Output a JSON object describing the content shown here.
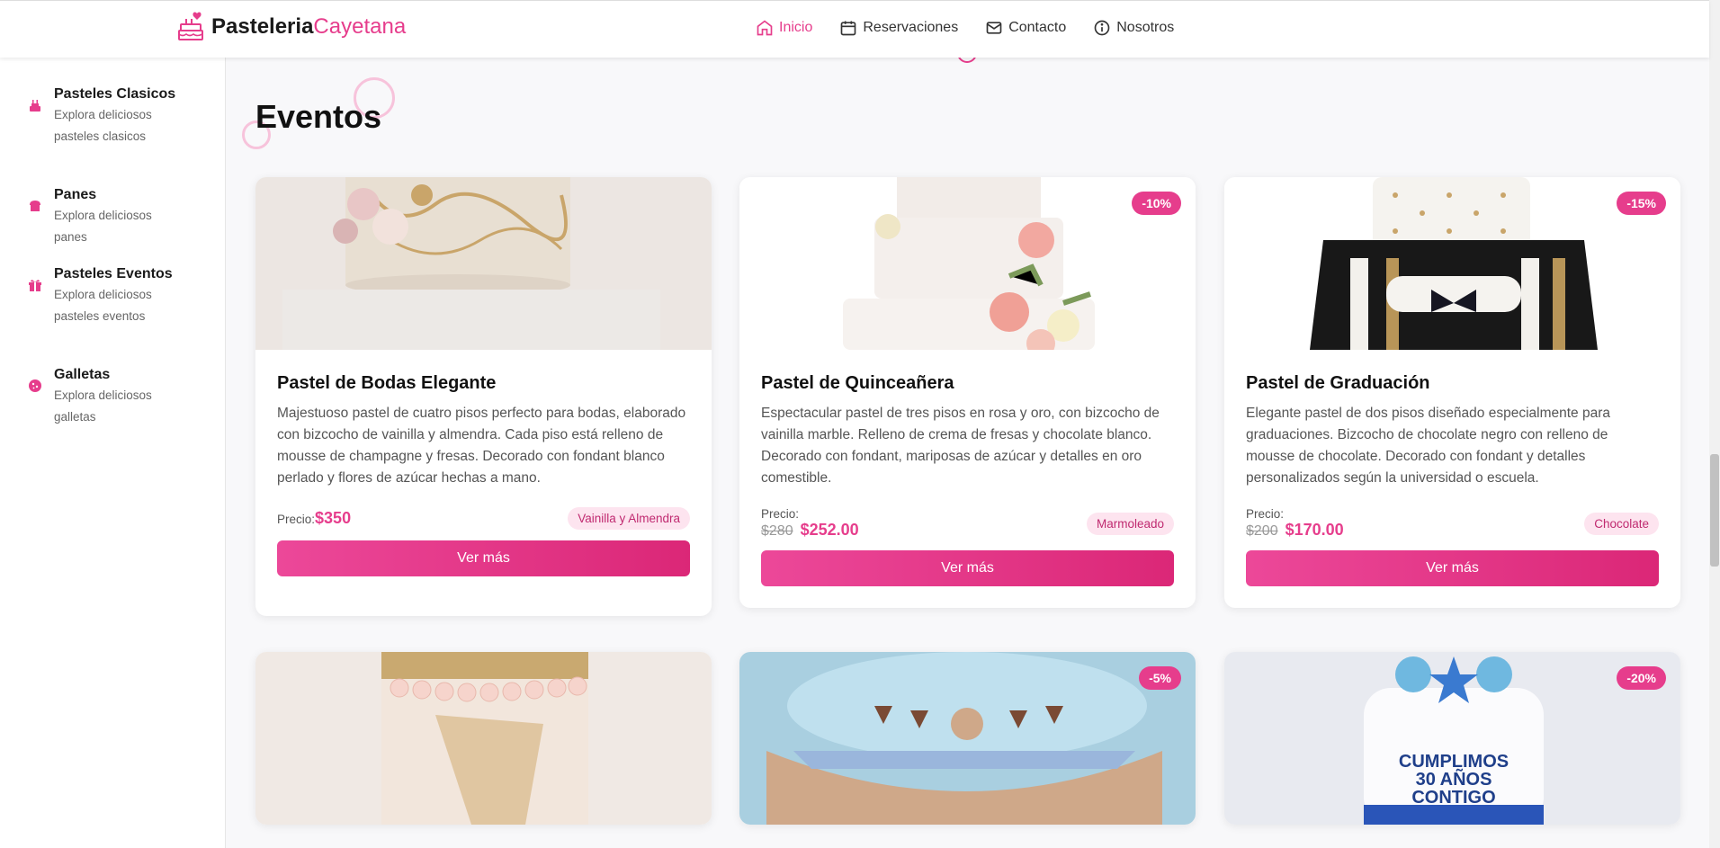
{
  "header": {
    "brand_bold": "Pasteleria",
    "brand_light": "Cayetana",
    "nav": [
      {
        "label": "Inicio",
        "icon": "home-icon"
      },
      {
        "label": "Reservaciones",
        "icon": "calendar-icon"
      },
      {
        "label": "Contacto",
        "icon": "mail-icon"
      },
      {
        "label": "Nosotros",
        "icon": "info-icon"
      }
    ]
  },
  "sidebar": {
    "items": [
      {
        "title": "Pasteles Clasicos",
        "desc": "Explora deliciosos pasteles clasicos",
        "icon": "cake-icon"
      },
      {
        "title": "Panes",
        "desc": "Explora deliciosos panes",
        "icon": "bread-icon"
      },
      {
        "title": "Pasteles Eventos",
        "desc": "Explora deliciosos pasteles eventos",
        "icon": "gift-icon"
      },
      {
        "title": "Galletas",
        "desc": "Explora deliciosos galletas",
        "icon": "cookie-icon"
      }
    ]
  },
  "main": {
    "title": "Eventos",
    "cards": [
      {
        "title": "Pastel de Bodas Elegante",
        "desc": "Majestuoso pastel de cuatro pisos perfecto para bodas, elaborado con bizcocho de vainilla y almendra. Cada piso está relleno de mousse de champagne y fresas. Decorado con fondant blanco perlado y flores de azúcar hechas a mano.",
        "price_label": "Precio:",
        "price": "$350",
        "flavor": "Vainilla y Almendra",
        "button": "Ver más"
      },
      {
        "title": "Pastel de Quinceañera",
        "desc": "Espectacular pastel de tres pisos en rosa y oro, con bizcocho de vainilla marble. Relleno de crema de fresas y chocolate blanco. Decorado con fondant, mariposas de azúcar y detalles en oro comestible.",
        "price_label": "Precio:",
        "old_price": "$280",
        "price": "$252.00",
        "badge": "-10%",
        "flavor": "Marmoleado",
        "button": "Ver más"
      },
      {
        "title": "Pastel de Graduación",
        "desc": "Elegante pastel de dos pisos diseñado especialmente para graduaciones. Bizcocho de chocolate negro con relleno de mousse de chocolate. Decorado con fondant y detalles personalizados según la universidad o escuela.",
        "price_label": "Precio:",
        "old_price": "$200",
        "price": "$170.00",
        "badge": "-15%",
        "flavor": "Chocolate",
        "button": "Ver más"
      }
    ],
    "row2_badges": [
      "-5%",
      "-20%"
    ],
    "row2_cake_text": [
      "CUMPLIMOS",
      "30 AÑOS",
      "CONTIGO"
    ]
  },
  "colors": {
    "accent": "#e63d8c",
    "accent_dark": "#db2777",
    "badge_bg": "#fde4ef"
  }
}
